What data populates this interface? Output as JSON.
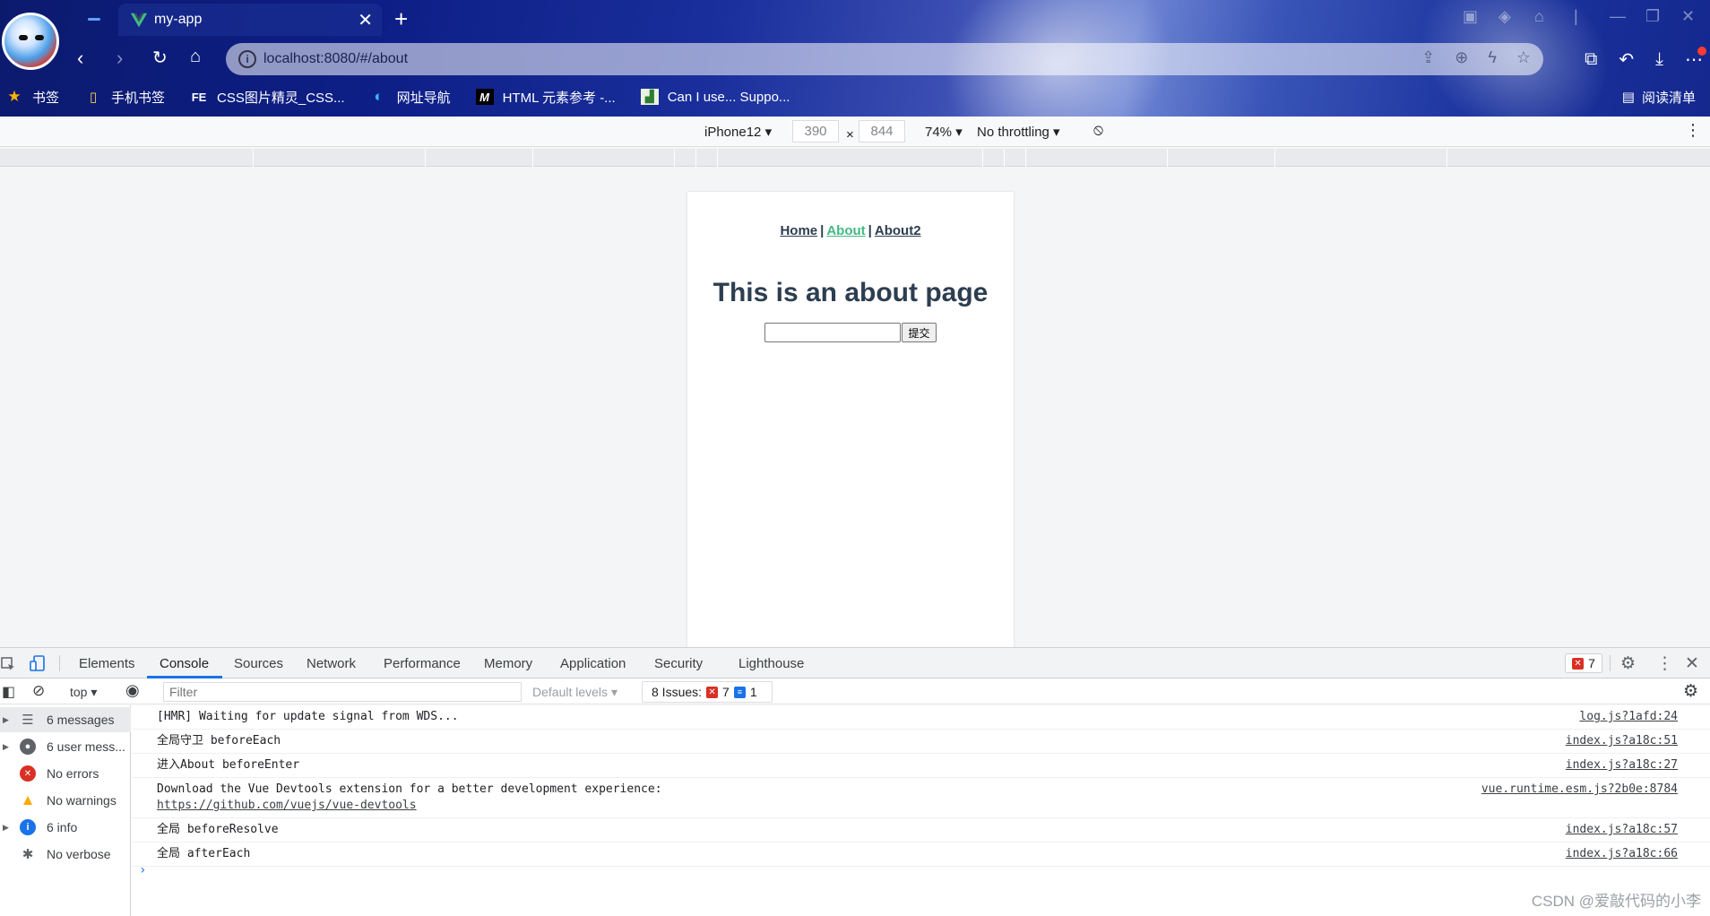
{
  "browser": {
    "tab_title": "my-app",
    "address": "localhost:8080/#/about",
    "bookmarks": [
      {
        "label": "书签",
        "icon": "star-icon"
      },
      {
        "label": "手机书签",
        "icon": "phone-bookmark-icon"
      },
      {
        "label": "CSS图片精灵_CSS...",
        "icon": "fe-icon"
      },
      {
        "label": "网址导航",
        "icon": "edge-icon"
      },
      {
        "label": "HTML 元素参考 -...",
        "icon": "mdn-icon"
      },
      {
        "label": "Can I use... Suppo...",
        "icon": "caniuse-icon"
      }
    ],
    "reader_label": "阅读清单"
  },
  "device_toolbar": {
    "device": "iPhone12",
    "width": "390",
    "height": "844",
    "times": "×",
    "zoom": "74%",
    "throttling": "No throttling"
  },
  "page": {
    "nav": {
      "home": "Home",
      "about": "About",
      "about2": "About2",
      "sep": "|"
    },
    "title": "This is an about page",
    "submit_label": "提交"
  },
  "devtools": {
    "tabs": [
      "Elements",
      "Console",
      "Sources",
      "Network",
      "Performance",
      "Memory",
      "Application",
      "Security",
      "Lighthouse"
    ],
    "active_tab": "Console",
    "error_count": "7",
    "context": "top",
    "filter_placeholder": "Filter",
    "levels": "Default levels",
    "issues_label": "8 Issues:",
    "issues_errors": "7",
    "issues_info": "1",
    "sidebar": [
      {
        "label": "6 messages",
        "icon": "list-icon",
        "caret": true
      },
      {
        "label": "6 user mess...",
        "icon": "user-icon",
        "caret": true
      },
      {
        "label": "No errors",
        "icon": "error-icon",
        "caret": false
      },
      {
        "label": "No warnings",
        "icon": "warning-icon",
        "caret": false
      },
      {
        "label": "6 info",
        "icon": "info-icon",
        "caret": true
      },
      {
        "label": "No verbose",
        "icon": "bug-icon",
        "caret": false
      }
    ],
    "messages": [
      {
        "text": "[HMR] Waiting for update signal from WDS...",
        "source": "log.js?1afd:24"
      },
      {
        "text": "全局守卫 beforeEach",
        "source": "index.js?a18c:51"
      },
      {
        "text": "进入About beforeEnter",
        "source": "index.js?a18c:27"
      },
      {
        "text": "Download the Vue Devtools extension for a better development experience:",
        "link": "https://github.com/vuejs/vue-devtools",
        "source": "vue.runtime.esm.js?2b0e:8784"
      },
      {
        "text": "全局 beforeResolve",
        "source": "index.js?a18c:57"
      },
      {
        "text": "全局 afterEach",
        "source": "index.js?a18c:66"
      }
    ],
    "prompt": "›"
  },
  "watermark": "CSDN @爱敲代码的小李",
  "colors": {
    "vue_green": "#42b983",
    "vue_text": "#2c3e50",
    "devtools_blue": "#1a73e8",
    "error_red": "#d93025"
  }
}
